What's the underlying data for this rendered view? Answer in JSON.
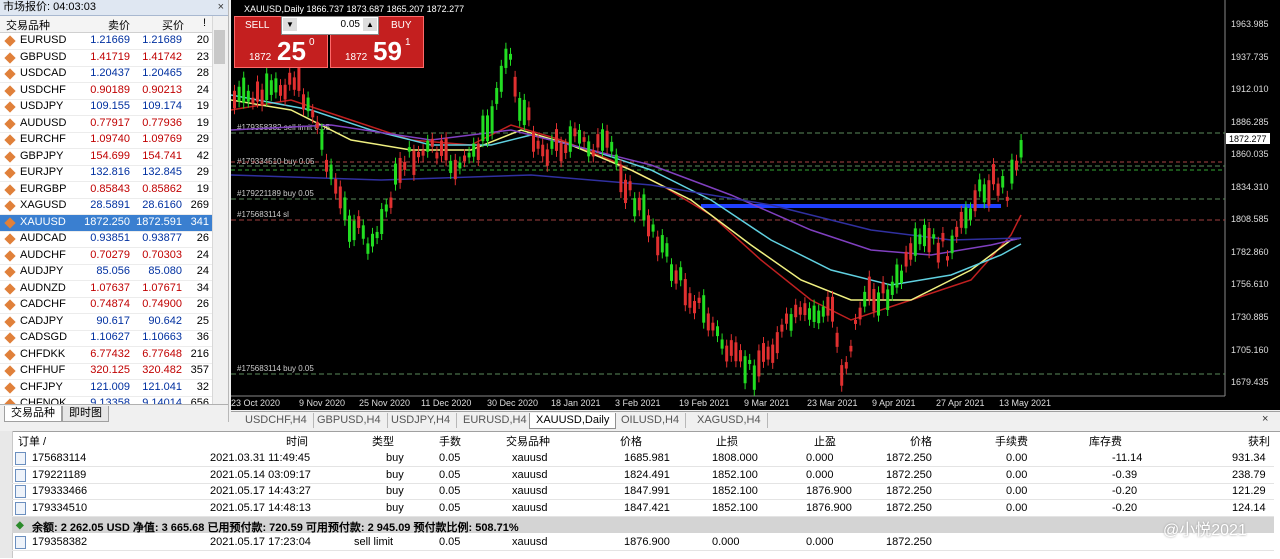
{
  "market_watch": {
    "title": "市场报价: 04:03:03",
    "close": "×",
    "columns": {
      "symbol": "交易品种",
      "bid": "卖价",
      "ask": "买价",
      "spread": "!"
    },
    "rows": [
      {
        "symbol": "EURUSD",
        "bid": "1.21669",
        "ask": "1.21689",
        "spread": "20"
      },
      {
        "symbol": "GBPUSD",
        "bid": "1.41719",
        "ask": "1.41742",
        "spread": "23"
      },
      {
        "symbol": "USDCAD",
        "bid": "1.20437",
        "ask": "1.20465",
        "spread": "28"
      },
      {
        "symbol": "USDCHF",
        "bid": "0.90189",
        "ask": "0.90213",
        "spread": "24"
      },
      {
        "symbol": "USDJPY",
        "bid": "109.155",
        "ask": "109.174",
        "spread": "19"
      },
      {
        "symbol": "AUDUSD",
        "bid": "0.77917",
        "ask": "0.77936",
        "spread": "19"
      },
      {
        "symbol": "EURCHF",
        "bid": "1.09740",
        "ask": "1.09769",
        "spread": "29"
      },
      {
        "symbol": "GBPJPY",
        "bid": "154.699",
        "ask": "154.741",
        "spread": "42"
      },
      {
        "symbol": "EURJPY",
        "bid": "132.816",
        "ask": "132.845",
        "spread": "29"
      },
      {
        "symbol": "EURGBP",
        "bid": "0.85843",
        "ask": "0.85862",
        "spread": "19"
      },
      {
        "symbol": "XAGUSD",
        "bid": "28.5891",
        "ask": "28.6160",
        "spread": "269"
      },
      {
        "symbol": "XAUUSD",
        "bid": "1872.250",
        "ask": "1872.591",
        "spread": "341"
      },
      {
        "symbol": "AUDCAD",
        "bid": "0.93851",
        "ask": "0.93877",
        "spread": "26"
      },
      {
        "symbol": "AUDCHF",
        "bid": "0.70279",
        "ask": "0.70303",
        "spread": "24"
      },
      {
        "symbol": "AUDJPY",
        "bid": "85.056",
        "ask": "85.080",
        "spread": "24"
      },
      {
        "symbol": "AUDNZD",
        "bid": "1.07637",
        "ask": "1.07671",
        "spread": "34"
      },
      {
        "symbol": "CADCHF",
        "bid": "0.74874",
        "ask": "0.74900",
        "spread": "26"
      },
      {
        "symbol": "CADJPY",
        "bid": "90.617",
        "ask": "90.642",
        "spread": "25"
      },
      {
        "symbol": "CADSGD",
        "bid": "1.10627",
        "ask": "1.10663",
        "spread": "36"
      },
      {
        "symbol": "CHFDKK",
        "bid": "6.77432",
        "ask": "6.77648",
        "spread": "216"
      },
      {
        "symbol": "CHFHUF",
        "bid": "320.125",
        "ask": "320.482",
        "spread": "357"
      },
      {
        "symbol": "CHFJPY",
        "bid": "121.009",
        "ask": "121.041",
        "spread": "32"
      },
      {
        "symbol": "CHFNOK",
        "bid": "9.13358",
        "ask": "9.14014",
        "spread": "656"
      }
    ],
    "tabs": [
      "交易品种",
      "即时图"
    ]
  },
  "chart": {
    "title": "XAUUSD,Daily  1866.737 1873.687 1865.207 1872.277",
    "current_price": "1872.277",
    "price_labels": [
      "1963.985",
      "1937.735",
      "1912.010",
      "1886.285",
      "1860.035",
      "1834.310",
      "1808.585",
      "1782.860",
      "1756.610",
      "1730.885",
      "1705.160",
      "1679.435"
    ],
    "date_labels": [
      "23 Oct 2020",
      "9 Nov 2020",
      "25 Nov 2020",
      "11 Dec 2020",
      "30 Dec 2020",
      "18 Jan 2021",
      "3 Feb 2021",
      "19 Feb 2021",
      "9 Mar 2021",
      "23 Mar 2021",
      "9 Apr 2021",
      "27 Apr 2021",
      "13 May 2021"
    ],
    "order_labels": [
      "#179358382 sell limit 0.05",
      "#179334510 buy 0.05",
      "#179221189 buy 0.05",
      "#175683114 sl",
      "#175683114 buy 0.05"
    ]
  },
  "ticket": {
    "sell_label": "SELL",
    "buy_label": "BUY",
    "lot": "0.05",
    "sell_prefix": "1872",
    "sell_big": "25",
    "sell_sup": "0",
    "buy_prefix": "1872",
    "buy_big": "59",
    "buy_sup": "1",
    "lot_down": "▼",
    "lot_up": "▲"
  },
  "chart_tabs": [
    "USDCHF,H4",
    "GBPUSD,H4",
    "USDJPY,H4",
    "EURUSD,H4",
    "XAUUSD,Daily",
    "OILUSD,H4",
    "XAGUSD,H4"
  ],
  "terminal": {
    "close": "×",
    "columns": {
      "order": "订单 /",
      "time": "时间",
      "type": "类型",
      "lots": "手数",
      "symbol": "交易品种",
      "price": "价格",
      "sl": "止损",
      "tp": "止盈",
      "cur_price": "价格",
      "commission": "手续费",
      "swap": "库存费",
      "profit": "获利"
    },
    "rows": [
      {
        "order": "175683114",
        "time": "2021.03.31 11:49:45",
        "type": "buy",
        "lots": "0.05",
        "symbol": "xauusd",
        "price": "1685.981",
        "sl": "1808.000",
        "tp": "0.000",
        "cur_price": "1872.250",
        "commission": "0.00",
        "swap": "-11.14",
        "profit": "931.34"
      },
      {
        "order": "179221189",
        "time": "2021.05.14 03:09:17",
        "type": "buy",
        "lots": "0.05",
        "symbol": "xauusd",
        "price": "1824.491",
        "sl": "1852.100",
        "tp": "0.000",
        "cur_price": "1872.250",
        "commission": "0.00",
        "swap": "-0.39",
        "profit": "238.79"
      },
      {
        "order": "179333466",
        "time": "2021.05.17 14:43:27",
        "type": "buy",
        "lots": "0.05",
        "symbol": "xauusd",
        "price": "1847.991",
        "sl": "1852.100",
        "tp": "1876.900",
        "cur_price": "1872.250",
        "commission": "0.00",
        "swap": "-0.20",
        "profit": "121.29"
      },
      {
        "order": "179334510",
        "time": "2021.05.17 14:48:13",
        "type": "buy",
        "lots": "0.05",
        "symbol": "xauusd",
        "price": "1847.421",
        "sl": "1852.100",
        "tp": "1876.900",
        "cur_price": "1872.250",
        "commission": "0.00",
        "swap": "-0.20",
        "profit": "124.14"
      }
    ],
    "summary": "余额: 2 262.05 USD  净值: 3 665.68  已用预付款: 720.59  可用预付款: 2 945.09  预付款比例: 508.71%",
    "pending": {
      "order": "179358382",
      "time": "2021.05.17 17:23:04",
      "type": "sell limit",
      "lots": "0.05",
      "symbol": "xauusd",
      "price": "1876.900",
      "sl": "0.000",
      "tp": "0.000",
      "cur_price": "1872.250"
    }
  },
  "watermark": "@小悦2021"
}
